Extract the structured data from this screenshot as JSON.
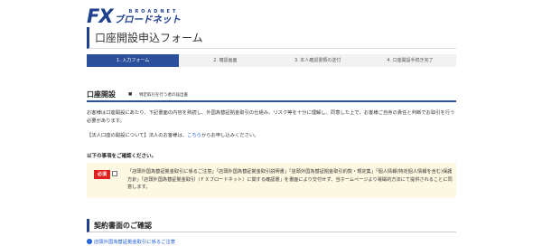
{
  "logo": {
    "fx": "FX",
    "en": "BROADNET",
    "jp": "ブロードネット"
  },
  "page": {
    "title": "口座開設申込フォーム"
  },
  "steps": [
    {
      "label": "1. 入力フォーム",
      "active": true
    },
    {
      "label": "2. 確認画面",
      "active": false
    },
    {
      "label": "3. 本人確認書類の送付",
      "active": false
    },
    {
      "label": "4. 口座開設手続き完了",
      "active": false
    }
  ],
  "section": {
    "title": "口座開設",
    "mark": "■",
    "sub": "特定取引を行う者の届出書"
  },
  "intro": "お客様は口座開設にあたり、下記書面の内容を熟読し、外国為替証拠金取引の仕組み、リスク等を十分に理解し、同意した上で、お客様ご自身の責任と判断でお取引を行う必要があります。",
  "corp_note": {
    "prefix": "【法人口座の開設について】法人のお客様は、",
    "link": "こちら",
    "suffix": "からお申し込みください。"
  },
  "check": {
    "heading": "以下の事項をご確認ください。",
    "badge": "必須",
    "text": "「店頭外国為替証拠金取引に係るご注意」「店頭外国為替証拠金取引説明書」「店頭外国為替証拠金取引約款・規定集」「個人情報(特定個人情報を含む)保護方針」「店頭外国為替証拠金取引（ＦＸブロードネット）に関する確認書」を書面により交付せず、当ホームページより電磁的方法にて提供されることに同意します。"
  },
  "section2": {
    "title": "契約書面のご確認"
  },
  "doc_link": {
    "icon": "›",
    "label": "店頭外国為替証拠金取引に係るご注意"
  },
  "colors": {
    "brand": "#1f3f8f",
    "active_step": "#2b4f9a",
    "required": "#e01f1f",
    "link": "#1a5bd6",
    "confirm_bg": "#fdf8e1"
  }
}
